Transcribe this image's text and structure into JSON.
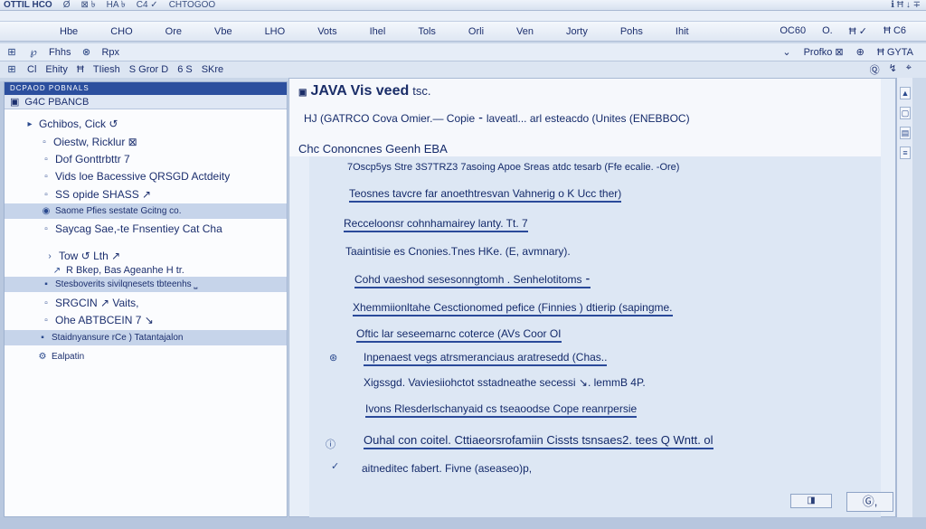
{
  "titlebar": {
    "app_name": "OTTIL HCO",
    "items": [
      "Ø",
      "⊠ ৳",
      "HA ৳",
      "C4 ✓",
      "CHTOGOO"
    ],
    "right_text": "ℹ Ħ ↓ ∓"
  },
  "menubar": {
    "items": [
      "Hbe",
      "CHO",
      "Ore",
      "Vbe",
      "LHO",
      "Vots",
      "Ihel",
      "Tols",
      "Orli",
      "Ven",
      "Jorty",
      "Pohs",
      "Ihit"
    ],
    "right_items": [
      "OC60",
      "O.",
      "Ħ ✓",
      "Ħ C6"
    ]
  },
  "toolbar1": {
    "left_items": [
      "⊞",
      "℘",
      "Fhhs",
      "⊗",
      "Rpx"
    ],
    "right_items": [
      "⌄",
      "Profko ⊠",
      "⊕",
      "Ħ GYTA"
    ]
  },
  "toolbar2": {
    "items": [
      "⊞",
      "Cl",
      "Ehity",
      "Ħ",
      "TIiesh",
      "S Gror D",
      "6 S",
      "SKre"
    ],
    "right_items": [
      "Ⓠ",
      "↯",
      "⌖"
    ]
  },
  "left_panel": {
    "header": "DCPAOD POBNALS",
    "sub_label": "G4C PBANCB",
    "items": [
      {
        "label": "Gchibos, Cick ↺",
        "icon": "folder-icon"
      },
      {
        "label": "Oiestw, Ricklur ⊠",
        "icon": "file-icon"
      },
      {
        "label": "Dof Gonttrbttr 7",
        "icon": "file-icon"
      },
      {
        "label": "Vids loe Bacessive QRSGD Actdeity",
        "icon": "file-icon"
      },
      {
        "label": "SS opide SHASS ↗",
        "icon": "file-icon"
      },
      {
        "label": "Saome Pfies sestate Gcitng co.",
        "icon": "file-icon"
      },
      {
        "label": "Saycag Sae,-te Fnsentiey Cat Cha",
        "icon": "file-icon"
      },
      {
        "label": "Tow ↺ Lth ↗",
        "icon": "folder-icon"
      },
      {
        "label": "R Bkep, Bas Ageanhe H tr.",
        "icon": "file-icon"
      },
      {
        "label": "Stesboverits sivilqnesets tbteenhs ⎵",
        "icon": "file-icon"
      },
      {
        "label": "SRGCIN ↗ Vaits,",
        "icon": "file-icon"
      },
      {
        "label": "Ohe ABTBCEIN 7 ↘",
        "icon": "file-icon"
      },
      {
        "label": "Staidnyansure rCe ) Tatantajalon",
        "icon": "file-icon"
      },
      {
        "label": "Ealpatin",
        "icon": "gear-icon"
      }
    ]
  },
  "editor": {
    "title": "JAVA Vis veed",
    "title_small": "tsc.",
    "head_line1": "HJ (GATRCO Cova Omier.— Copie ⁃ laveatl... arl esteacdo (Unites (ENEBBOC)",
    "head_line2": "Chc Cononcnes Geenh EBA",
    "lines": [
      "7Oscp5ys Stre 3S7TRZ3 7asoing Apoe Sreas atdc tesarb (Ffe ecalie. -Ore)",
      "Teosnes tavcre far anoethtresvan Vahnerig o K Ucc ther)",
      "Recceloonsr cohnhamairey lanty. Tt. 7",
      "Taaintisie es Cnonies.Tnes HKe. (E, avmnary).",
      "Cohd vaeshod sesesonngtomh . Senhelotitoms ⁃",
      "Xhemmiionltahe Cesctionomed pefice (Finnies ) dtierip (sapingme.",
      "Oftic lar seseemarnc coterce (AVs Coor OI ",
      "Inpenaest vegs atrsmeranciaus aratresedd (Chas..",
      "Xigssgd. Vaviesiiohctot sstadneathe secessi ↘. lemmB 4P.",
      "Ivons Rlesderlschanyaid cs tseaoodse Cope reanrpersie",
      "Ouhal con coitel. Cttiaeorsrofamiin Cissts tsnsaes2. tees Q Wntt. ol",
      "aitneditec fabert. Fivne (aseaseo)p,"
    ]
  },
  "scroll": {
    "up": "▲",
    "mid1": "▢",
    "mid2": "▤",
    "down": "≡"
  },
  "status": {
    "btn1": "◨",
    "btn2": "Ⓖ,"
  }
}
